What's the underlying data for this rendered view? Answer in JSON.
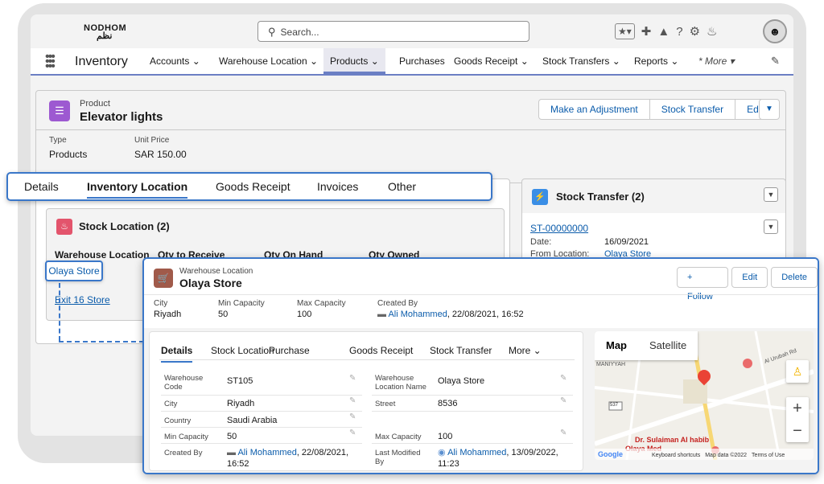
{
  "topbar": {
    "logo": "NODHOM",
    "logo_ar": "نظم",
    "search_placeholder": "Search..."
  },
  "nav": {
    "app_name": "Inventory",
    "items": [
      "Accounts",
      "Warehouse Location",
      "Products",
      "Purchases",
      "Goods Receipt",
      "Stock Transfers",
      "Reports",
      "* More"
    ],
    "active": "Products"
  },
  "product": {
    "label": "Product",
    "title": "Elevator lights",
    "buttons": [
      "Make an Adjustment",
      "Stock Transfer",
      "Edit"
    ],
    "type_label": "Type",
    "type_value": "Products",
    "price_label": "Unit Price",
    "price_value": "SAR 150.00"
  },
  "tabs": [
    "Details",
    "Inventory Location",
    "Goods Receipt",
    "Invoices",
    "Other"
  ],
  "stock_location": {
    "title": "Stock Location (2)",
    "columns": [
      "Warehouse Location",
      "Qty to Receive",
      "Qty On Hand",
      "Qty Owned"
    ],
    "rows": [
      "Olaya Store",
      "Exit 16 Store"
    ]
  },
  "stock_transfer": {
    "title": "Stock Transfer (2)",
    "record": "ST-00000000",
    "date_label": "Date:",
    "date_value": "16/09/2021",
    "from_label": "From Location:",
    "from_value": "Olaya Store"
  },
  "warehouse": {
    "label": "Warehouse Location",
    "title": "Olaya Store",
    "buttons": [
      "+ Follow",
      "Edit",
      "Delete"
    ],
    "city_label": "City",
    "city_value": "Riyadh",
    "min_label": "Min Capacity",
    "min_value": "50",
    "max_label": "Max Capacity",
    "max_value": "100",
    "created_label": "Created By",
    "created_user": "Ali Mohammed",
    "created_date": ", 22/08/2021, 16:52"
  },
  "detail_tabs": [
    "Details",
    "Stock Location",
    "Purchase",
    "Goods Receipt",
    "Stock Transfer",
    "More"
  ],
  "fields": {
    "code_label": "Warehouse Code",
    "code_value": "ST105",
    "name_label": "Warehouse Location Name",
    "name_value": "Olaya Store",
    "city_label": "City",
    "city_value": "Riyadh",
    "street_label": "Street",
    "street_value": "8536",
    "country_label": "Country",
    "country_value": "Saudi Arabia",
    "min_label": "Min Capacity",
    "min_value": "50",
    "max_label": "Max Capacity",
    "max_value": "100",
    "created_label": "Created By",
    "created_user": "Ali Mohammed",
    "created_date1": ", 22/08/2021,",
    "created_date2": "16:52",
    "modified_label": "Last Modified By",
    "modified_user": "Ali Mohammed",
    "modified_date1": ", 13/09/2022,",
    "modified_date2": "11:23"
  },
  "map": {
    "tabs": [
      "Map",
      "Satellite"
    ],
    "area": "MANIYYAH",
    "road": "Al Urubah Rd",
    "place": "Dr. Sulaiman Al habib",
    "place2": "Olaya Med",
    "google": "Google",
    "footer1": "Keyboard shortcuts",
    "footer2": "Map data ©2022",
    "footer3": "Terms of Use",
    "road_num": "537"
  }
}
